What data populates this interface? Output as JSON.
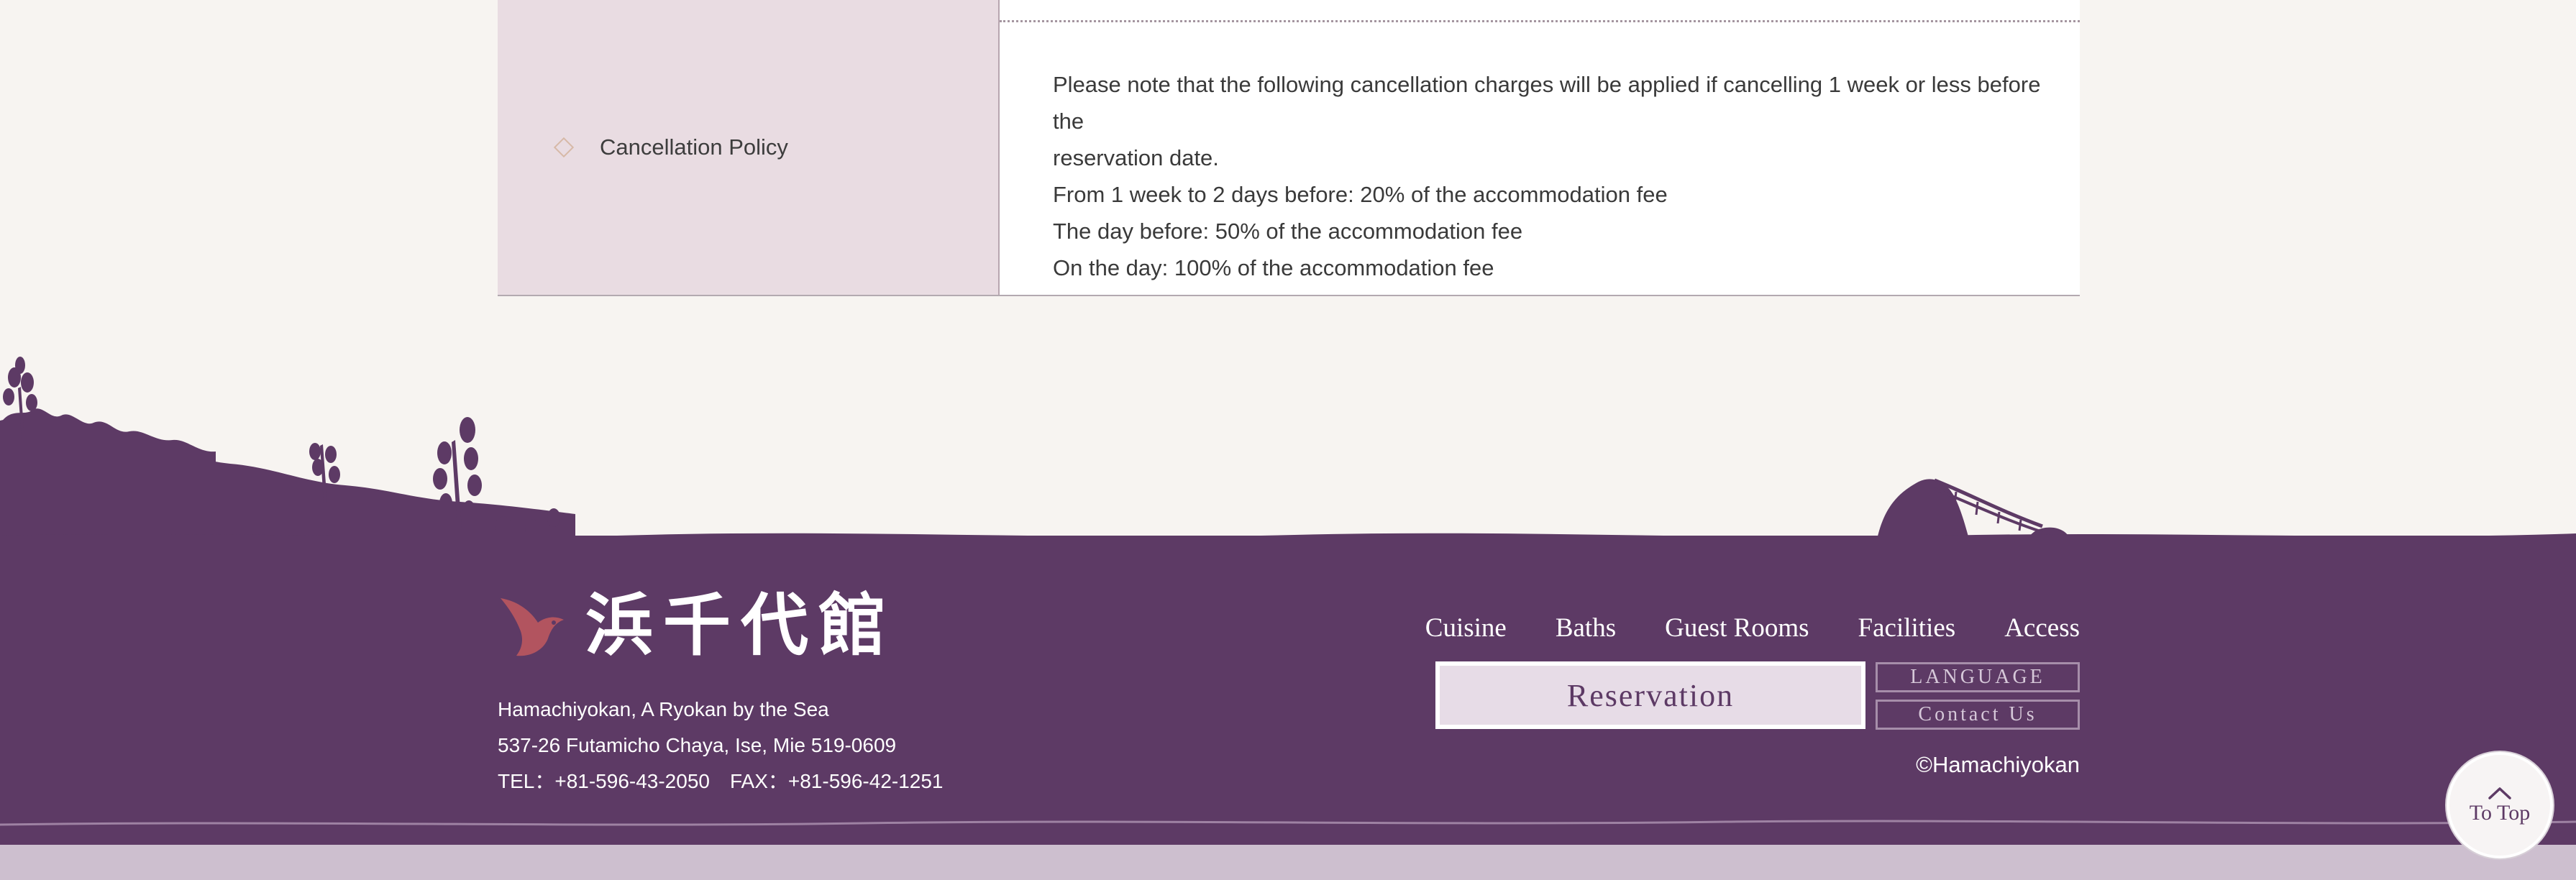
{
  "policy": {
    "label": "Cancellation Policy",
    "lines": [
      "Please note that the following cancellation charges will be applied if cancelling 1 week or less before the",
      "reservation date.",
      "From 1 week to 2 days before: 20% of the accommodation fee",
      "The day before: 50% of the accommodation fee",
      "On the day: 100% of the accommodation fee"
    ]
  },
  "footer": {
    "logo_text": "浜千代館",
    "address": {
      "name": "Hamachiyokan, A Ryokan by the Sea",
      "street": "537-26 Futamicho Chaya, Ise, Mie 519-0609",
      "phone": "TEL：+81-596-43-2050　FAX：+81-596-42-1251"
    },
    "nav": [
      "Cuisine",
      "Baths",
      "Guest Rooms",
      "Facilities",
      "Access"
    ],
    "reservation_label": "Reservation",
    "language_label": "LANGUAGE",
    "contact_label": "Contact Us",
    "copyright": "©Hamachiyokan"
  },
  "to_top": {
    "label": "To Top",
    "icon": "chevron-up-icon"
  },
  "colors": {
    "footer_bg": "#5d3a65",
    "table_head_bg": "#e9dce2",
    "page_bg": "#f7f4f1",
    "logo_accent": "#b2545f"
  }
}
